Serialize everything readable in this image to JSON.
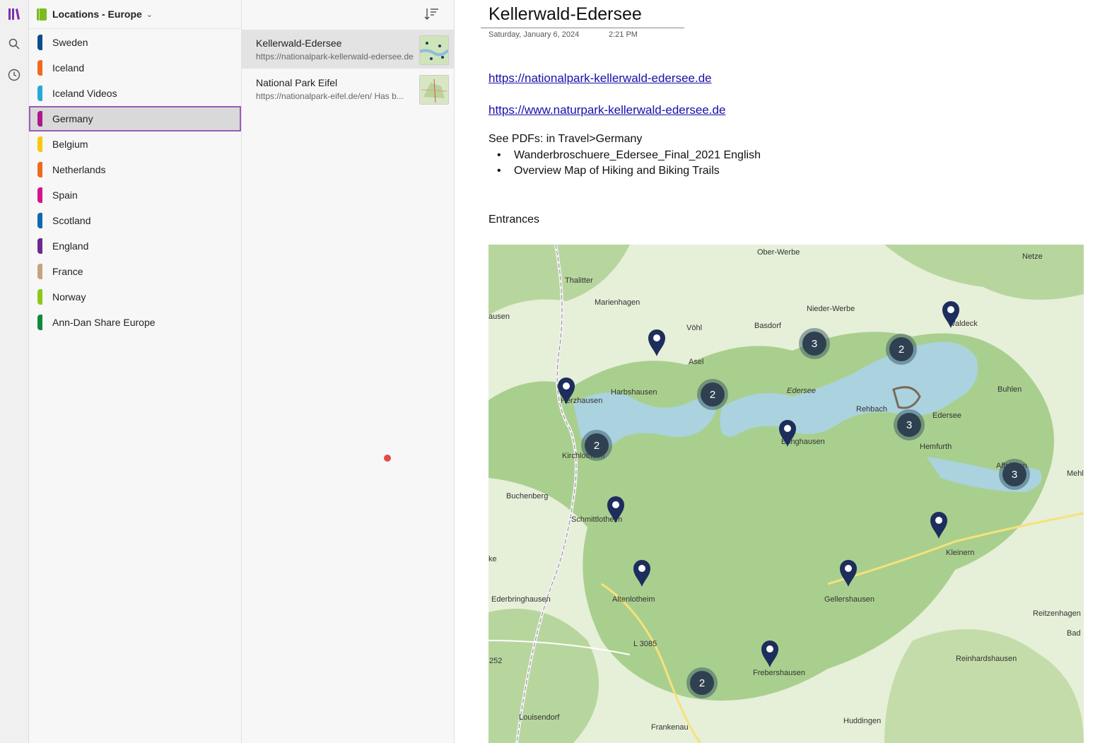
{
  "notebook": {
    "title": "Locations - Europe"
  },
  "sections": [
    {
      "label": "Sweden",
      "color": "#0f4c8a"
    },
    {
      "label": "Iceland",
      "color": "#f06a1e"
    },
    {
      "label": "Iceland Videos",
      "color": "#29a8d8"
    },
    {
      "label": "Germany",
      "color": "#b0168e",
      "selected": true
    },
    {
      "label": "Belgium",
      "color": "#f7c812"
    },
    {
      "label": "Netherlands",
      "color": "#f06a1e"
    },
    {
      "label": "Spain",
      "color": "#d4148c"
    },
    {
      "label": "Scotland",
      "color": "#1168b0"
    },
    {
      "label": "England",
      "color": "#6b2a8f"
    },
    {
      "label": "France",
      "color": "#c8a27c"
    },
    {
      "label": "Norway",
      "color": "#8cc81a"
    },
    {
      "label": "Ann-Dan Share Europe",
      "color": "#12883c"
    }
  ],
  "pages": [
    {
      "title": "Kellerwald-Edersee",
      "snippet": "https://nationalpark-kellerwald-edersee.de",
      "selected": true
    },
    {
      "title": "National Park Eifel",
      "snippet": "https://nationalpark-eifel.de/en/  Has b..."
    }
  ],
  "page": {
    "title": "Kellerwald-Edersee",
    "date": "Saturday, January 6, 2024",
    "time": "2:21 PM",
    "link1": "https://nationalpark-kellerwald-edersee.de",
    "link2": "https://www.naturpark-kellerwald-edersee.de",
    "see_pdfs": "See PDFs: in Travel>Germany",
    "bullets": [
      "Wanderbroschuere_Edersee_Final_2021 English",
      "Overview Map of Hiking and Biking Trails"
    ],
    "entrances": "Entrances"
  },
  "map": {
    "places": [
      "Ober-Werbe",
      "Netze",
      "Thalitter",
      "Marienhagen",
      "Nieder-Werbe",
      "Basdorf",
      "Vöhl",
      "Waldeck",
      "Asel",
      "Harbshausen",
      "Herzhausen",
      "Edersee",
      "Buhlen",
      "Rehbach",
      "Edersee",
      "Bringhausen",
      "Hemfurth",
      "Kirchlotheim",
      "Affoldern",
      "Mehlen",
      "Buchenberg",
      "Schmittlotheim",
      "Kleinern",
      "Ederbringhausen",
      "Altenlotheim",
      "Gellershausen",
      "Reitzenhagen",
      "Bad",
      "L 3085",
      "252",
      "Frebershausen",
      "Reinhardshausen",
      "Louisendorf",
      "Frankenau",
      "Huddingen",
      "ausen",
      "ke"
    ],
    "clusters": [
      "3",
      "2",
      "2",
      "3",
      "2",
      "3",
      "2"
    ]
  }
}
